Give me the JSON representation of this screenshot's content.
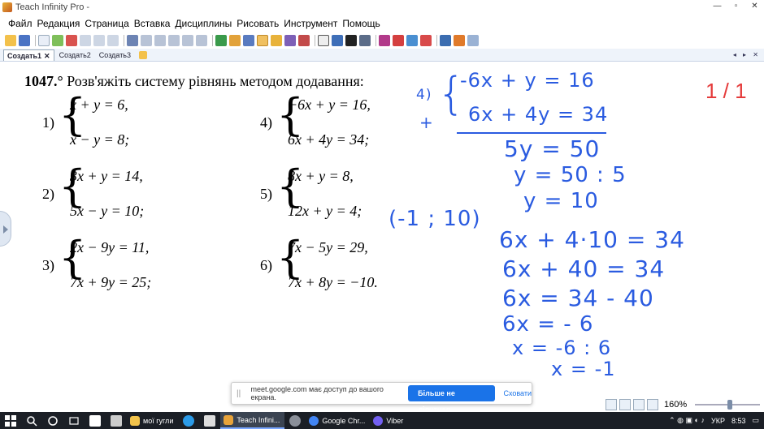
{
  "window": {
    "title": "Teach Infinity Pro -",
    "controls": [
      "—",
      "▫",
      "✕"
    ]
  },
  "menu": [
    "Файл",
    "Редакция",
    "Страница",
    "Вставка",
    "Дисциплины",
    "Рисовать",
    "Инструмент",
    "Помощь"
  ],
  "tabs": [
    {
      "label": "Создать1",
      "active": true,
      "close": "✕"
    },
    {
      "label": "Создать2",
      "active": false
    },
    {
      "label": "Создать3",
      "active": false
    }
  ],
  "tab_nav": "◂ ▸ ✕",
  "problem": {
    "number": "1047.°",
    "text": " Розв'яжіть систему рівнянь методом додавання:"
  },
  "systems": [
    {
      "num": "1)",
      "eq1": "x + y = 6,",
      "eq2": "x − y = 8;"
    },
    {
      "num": "2)",
      "eq1": "3x + y = 14,",
      "eq2": "5x − y = 10;"
    },
    {
      "num": "3)",
      "eq1": "2x − 9y = 11,",
      "eq2": "7x + 9y = 25;"
    },
    {
      "num": "4)",
      "eq1": "−6x + y = 16,",
      "eq2": "6x + 4y = 34;"
    },
    {
      "num": "5)",
      "eq1": "8x + y = 8,",
      "eq2": "12x + y = 4;"
    },
    {
      "num": "6)",
      "eq1": "7x − 5y = 29,",
      "eq2": "7x + 8y = −10."
    }
  ],
  "page_counter": "1 / 1",
  "handwriting": {
    "label": "4)",
    "plus": "+",
    "line1": "-6x + y = 16",
    "line2": "6x + 4y = 34",
    "sum": "5y = 50",
    "step1": "y = 50 : 5",
    "step2": "y = 10",
    "answer": "(-1 ; 10)",
    "sub1": "6x + 4·10 = 34",
    "sub2": "6x + 40 = 34",
    "sub3": "6x = 34 - 40",
    "sub4": "6x = - 6",
    "sub5": "x = -6 : 6",
    "sub6": "x = -1"
  },
  "share_banner": {
    "grip": "||",
    "message": "meet.google.com має доступ до вашого екрана.",
    "stop_label": "Більше не ділитися",
    "hide_label": "Сховати"
  },
  "status": {
    "zoom": "160%"
  },
  "taskbar": {
    "apps": [
      {
        "label": "мої гугли",
        "color": "#f2c34b",
        "active": false
      },
      {
        "label": "Teach Infini...",
        "color": "#e8a33a",
        "active": true
      },
      {
        "label": "Google Chr...",
        "color": "#4285f4",
        "active": false
      },
      {
        "label": "Viber",
        "color": "#7360f2",
        "active": false
      }
    ],
    "lang": "УКР",
    "time": "8:53"
  },
  "colors": {
    "ink": "#2a5be0",
    "counter": "#e53b3b",
    "taskbar": "#1b1f26",
    "share_button": "#1a73e8"
  }
}
